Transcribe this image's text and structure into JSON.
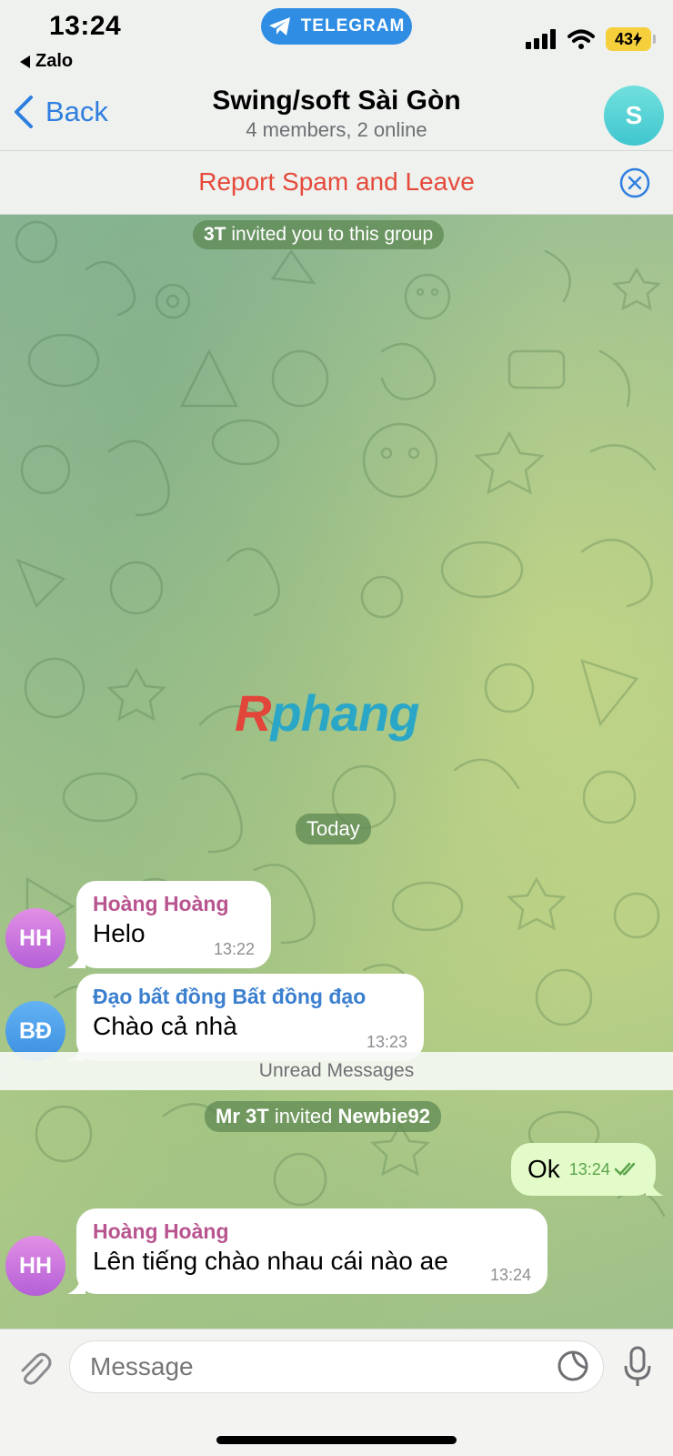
{
  "status": {
    "time": "13:24",
    "back_app": "Zalo",
    "pill_label": "TELEGRAM",
    "battery": "43"
  },
  "nav": {
    "back_label": "Back",
    "title": "Swing/soft Sài Gòn",
    "subtitle": "4 members, 2 online",
    "avatar_letter": "S"
  },
  "report": {
    "label": "Report Spam and Leave"
  },
  "chat": {
    "service1": {
      "actor": "3T",
      "text": "invited you to this group"
    },
    "watermark": {
      "first": "R",
      "rest": "phang"
    },
    "date_pill": "Today",
    "messages": [
      {
        "avatar": "HH",
        "sender": "Hoàng Hoàng",
        "sender_color": "#b8548f",
        "text": "Helo",
        "time": "13:22"
      },
      {
        "avatar": "BĐ",
        "sender": "Đạo bất đồng Bất đồng đạo",
        "sender_color": "#3b7fcf",
        "text": "Chào cả nhà",
        "time": "13:23"
      }
    ],
    "unread": "Unread Messages",
    "service2": {
      "actor": "Mr 3T",
      "text": "invited",
      "target": "Newbie92"
    },
    "outgoing": {
      "text": "Ok",
      "time": "13:24"
    },
    "last_message": {
      "avatar": "HH",
      "sender": "Hoàng Hoàng",
      "text": "Lên tiếng chào nhau cái nào ae",
      "time": "13:24"
    }
  },
  "input": {
    "placeholder": "Message"
  },
  "colors": {
    "accent": "#2f7fe0",
    "telegram_pill": "#2f8de4",
    "report_red": "#e54a3b",
    "outgoing_bubble": "#e3fbc9"
  }
}
